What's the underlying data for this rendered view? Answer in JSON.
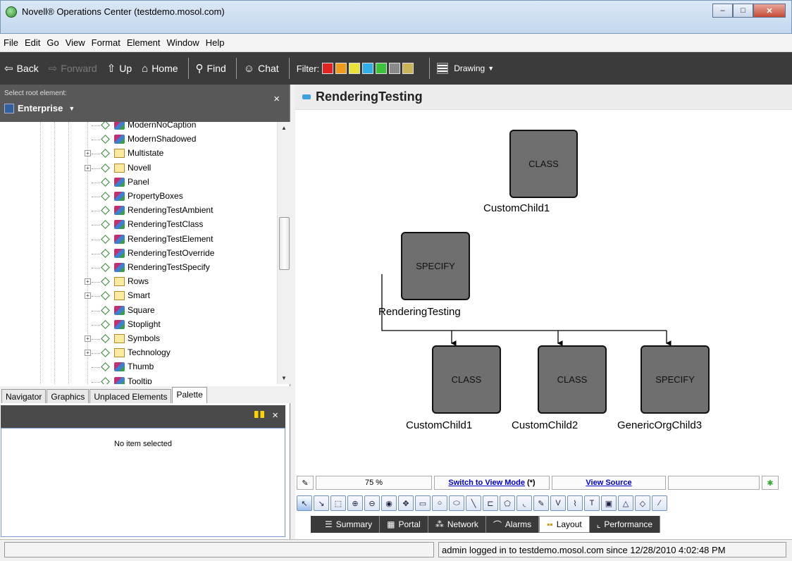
{
  "window": {
    "title": "Novell® Operations Center (testdemo.mosol.com)",
    "minimize": "–",
    "maximize": "□",
    "close": "✕"
  },
  "menu": {
    "items": [
      "File",
      "Edit",
      "Go",
      "View",
      "Format",
      "Element",
      "Window",
      "Help"
    ]
  },
  "toolbar": {
    "back": "Back",
    "forward": "Forward",
    "up": "Up",
    "home": "Home",
    "find": "Find",
    "chat": "Chat",
    "filter_label": "Filter:",
    "filter_colors": [
      "#e02424",
      "#f29b1a",
      "#e8e23a",
      "#2fb0e8",
      "#3cc23c",
      "#8a8a8a",
      "#c9b45a"
    ],
    "drawing": "Drawing"
  },
  "root": {
    "label": "Select root element:",
    "value": "Enterprise",
    "close": "×"
  },
  "tree": {
    "items": [
      {
        "label": "ModernNoCaption",
        "type": "element",
        "expandable": false
      },
      {
        "label": "ModernShadowed",
        "type": "element",
        "expandable": false
      },
      {
        "label": "Multistate",
        "type": "folder",
        "expandable": true
      },
      {
        "label": "Novell",
        "type": "folder",
        "expandable": true
      },
      {
        "label": "Panel",
        "type": "element",
        "expandable": false
      },
      {
        "label": "PropertyBoxes",
        "type": "element",
        "expandable": false
      },
      {
        "label": "RenderingTestAmbient",
        "type": "element",
        "expandable": false
      },
      {
        "label": "RenderingTestClass",
        "type": "element",
        "expandable": false
      },
      {
        "label": "RenderingTestElement",
        "type": "element",
        "expandable": false
      },
      {
        "label": "RenderingTestOverride",
        "type": "element",
        "expandable": false
      },
      {
        "label": "RenderingTestSpecify",
        "type": "element",
        "expandable": false
      },
      {
        "label": "Rows",
        "type": "folder",
        "expandable": true
      },
      {
        "label": "Smart",
        "type": "folder",
        "expandable": true
      },
      {
        "label": "Square",
        "type": "element",
        "expandable": false
      },
      {
        "label": "Stoplight",
        "type": "element",
        "expandable": false
      },
      {
        "label": "Symbols",
        "type": "folder",
        "expandable": true
      },
      {
        "label": "Technology",
        "type": "folder",
        "expandable": true
      },
      {
        "label": "Thumb",
        "type": "element",
        "expandable": false
      },
      {
        "label": "Tooltip",
        "type": "element",
        "expandable": false
      }
    ]
  },
  "panel_tabs": [
    "Navigator",
    "Graphics",
    "Unplaced Elements",
    "Palette"
  ],
  "palette": {
    "close": "×",
    "empty_text": "No item selected"
  },
  "view": {
    "title": "RenderingTesting",
    "nodes": [
      {
        "id": "top",
        "box": "CLASS",
        "label": "CustomChild1"
      },
      {
        "id": "root",
        "box": "SPECIFY",
        "label": "RenderingTesting"
      },
      {
        "id": "c1",
        "box": "CLASS",
        "label": "CustomChild1"
      },
      {
        "id": "c2",
        "box": "CLASS",
        "label": "CustomChild2"
      },
      {
        "id": "c3",
        "box": "SPECIFY",
        "label": "GenericOrgChild3"
      }
    ]
  },
  "status_row": {
    "zoom": "75 %",
    "switch_mode": "Switch to View Mode",
    "switch_suffix": "(*)",
    "view_source": "View Source"
  },
  "bottom_tabs": [
    "Summary",
    "Portal",
    "Network",
    "Alarms",
    "Layout",
    "Performance"
  ],
  "statusbar": {
    "message": "admin logged in to testdemo.mosol.com since 12/28/2010 4:02:48 PM"
  }
}
